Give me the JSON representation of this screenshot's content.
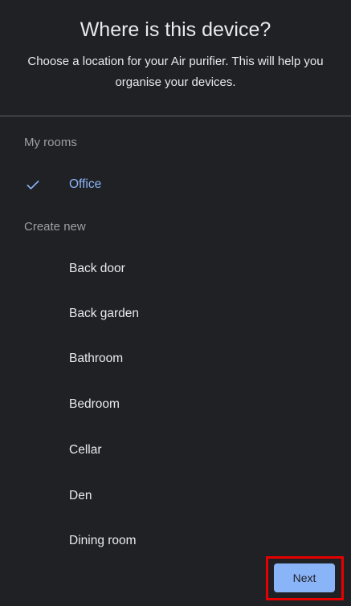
{
  "header": {
    "title": "Where is this device?",
    "subtitle": "Choose a location for your Air purifier. This will help you organise your devices."
  },
  "my_rooms": {
    "label": "My rooms",
    "items": [
      {
        "label": "Office",
        "selected": true
      }
    ]
  },
  "create_new": {
    "label": "Create new",
    "items": [
      {
        "label": "Back door"
      },
      {
        "label": "Back garden"
      },
      {
        "label": "Bathroom"
      },
      {
        "label": "Bedroom"
      },
      {
        "label": "Cellar"
      },
      {
        "label": "Den"
      },
      {
        "label": "Dining room"
      }
    ]
  },
  "footer": {
    "next_label": "Next"
  },
  "colors": {
    "background": "#202124",
    "accent": "#8ab4f8",
    "highlight_border": "#e60000"
  },
  "icons": {
    "selected": "check-icon"
  }
}
